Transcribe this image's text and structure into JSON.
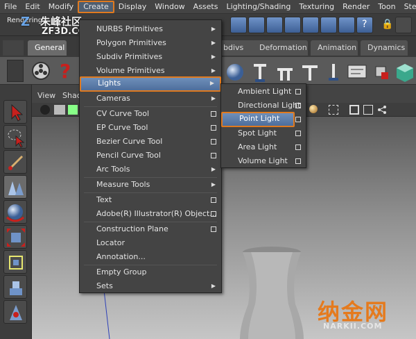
{
  "menubar": [
    "File",
    "Edit",
    "Modify",
    "Create",
    "Display",
    "Window",
    "Assets",
    "Lighting/Shading",
    "Texturing",
    "Render",
    "Toon",
    "Stereo"
  ],
  "watermark": {
    "site_cn": "朱峰社区",
    "site": "ZF3D.COM",
    "rendering": "Rendering"
  },
  "shelf_tabs": {
    "general": "General",
    "subdivs": "bdivs",
    "deformation": "Deformation",
    "animation": "Animation",
    "dynamics": "Dynamics"
  },
  "viewport_menu": {
    "view": "View",
    "shading": "Shad"
  },
  "create_menu": [
    {
      "label": "NURBS Primitives",
      "kind": "sub"
    },
    {
      "label": "Polygon Primitives",
      "kind": "sub"
    },
    {
      "label": "Subdiv Primitives",
      "kind": "sub"
    },
    {
      "label": "Volume Primitives",
      "kind": "sub"
    },
    {
      "label": "Lights",
      "kind": "sub",
      "highlight": true
    },
    {
      "label": "Cameras",
      "kind": "sub"
    },
    {
      "label": "CV Curve Tool",
      "kind": "opt"
    },
    {
      "label": "EP Curve Tool",
      "kind": "opt"
    },
    {
      "label": "Bezier Curve Tool",
      "kind": "opt"
    },
    {
      "label": "Pencil Curve Tool",
      "kind": "opt"
    },
    {
      "label": "Arc Tools",
      "kind": "sub"
    },
    {
      "label": "Measure Tools",
      "kind": "sub"
    },
    {
      "label": "Text",
      "kind": "opt"
    },
    {
      "label": "Adobe(R) Illustrator(R) Object...",
      "kind": "opt"
    },
    {
      "label": "Construction Plane",
      "kind": "opt"
    },
    {
      "label": "Locator",
      "kind": "none"
    },
    {
      "label": "Annotation...",
      "kind": "none"
    },
    {
      "label": "Empty Group",
      "kind": "none"
    },
    {
      "label": "Sets",
      "kind": "sub"
    }
  ],
  "lights_menu": [
    {
      "label": "Ambient Light"
    },
    {
      "label": "Directional Light"
    },
    {
      "label": "Point Light",
      "highlight": true
    },
    {
      "label": "Spot Light"
    },
    {
      "label": "Area Light"
    },
    {
      "label": "Volume Light"
    }
  ],
  "branding": {
    "logo": "纳金网",
    "url": "NARKII.COM"
  },
  "colors": {
    "highlight_border": "#e07a1f",
    "highlight_fill": "#5a7cab"
  }
}
